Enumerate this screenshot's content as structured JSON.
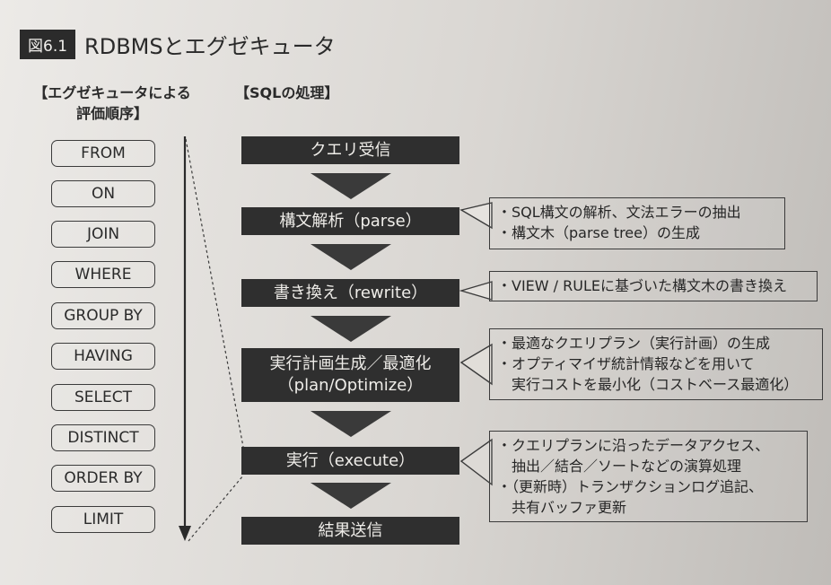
{
  "figure": {
    "number": "図6.1",
    "title": "RDBMSとエグゼキュータ"
  },
  "left_heading": {
    "line1": "【エグゼキュータによる",
    "line2": "評価順序】"
  },
  "right_heading": "【SQLの処理】",
  "evaluation_order": [
    "FROM",
    "ON",
    "JOIN",
    "WHERE",
    "GROUP BY",
    "HAVING",
    "SELECT",
    "DISTINCT",
    "ORDER BY",
    "LIMIT"
  ],
  "steps": [
    {
      "line1": "クエリ受信"
    },
    {
      "line1": "構文解析（parse）"
    },
    {
      "line1": "書き換え（rewrite）"
    },
    {
      "line1": "実行計画生成／最適化",
      "line2": "（plan/Optimize）"
    },
    {
      "line1": "実行（execute）"
    },
    {
      "line1": "結果送信"
    }
  ],
  "notes": {
    "parse": [
      "・SQL構文の解析、文法エラーの抽出",
      "・構文木（parse tree）の生成"
    ],
    "rewrite": [
      "・VIEW / RULEに基づいた構文木の書き換え"
    ],
    "plan": [
      "・最適なクエリプラン（実行計画）の生成",
      "・オプティマイザ統計情報などを用いて",
      "　実行コストを最小化（コストベース最適化）"
    ],
    "execute": [
      "・クエリプランに沿ったデータアクセス、",
      "　抽出／結合／ソートなどの演算処理",
      "・（更新時）トランザクションログ追記、",
      "　共有バッファ更新"
    ]
  }
}
